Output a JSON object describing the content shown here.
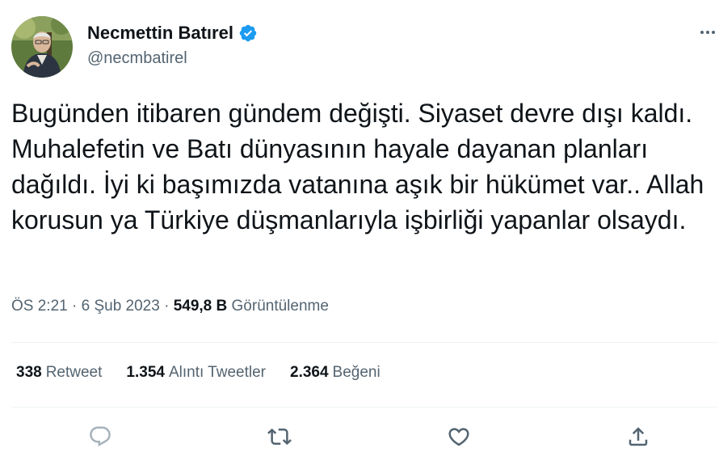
{
  "user": {
    "display_name": "Necmettin Batırel",
    "username": "@necmbatirel",
    "verified": true
  },
  "tweet": {
    "text": "Bugünden itibaren gündem değişti. Siyaset devre dışı kaldı. Muhalefetin ve Batı dünyasının hayale dayanan planları dağıldı. İyi ki başımızda vatanına aşık bir hükümet var.. Allah korusun ya Türkiye düşmanlarıyla işbirliği yapanlar olsaydı.",
    "time": "ÖS 2:21",
    "separator": "·",
    "date": "6 Şub 2023",
    "views_count": "549,8 B",
    "views_label": "Görüntülenme"
  },
  "stats": {
    "retweets": {
      "count": "338",
      "label": "Retweet"
    },
    "quotes": {
      "count": "1.354",
      "label": "Alıntı Tweetler"
    },
    "likes": {
      "count": "2.364",
      "label": "Beğeni"
    }
  },
  "icons": {
    "verified": "verified-badge-icon",
    "more": "more-icon",
    "reply": "reply-icon",
    "retweet": "retweet-icon",
    "like": "heart-icon",
    "share": "share-icon"
  },
  "colors": {
    "verified_blue": "#1d9bf0",
    "text_primary": "#0f1419",
    "text_secondary": "#536471",
    "divider": "#eff3f4"
  }
}
